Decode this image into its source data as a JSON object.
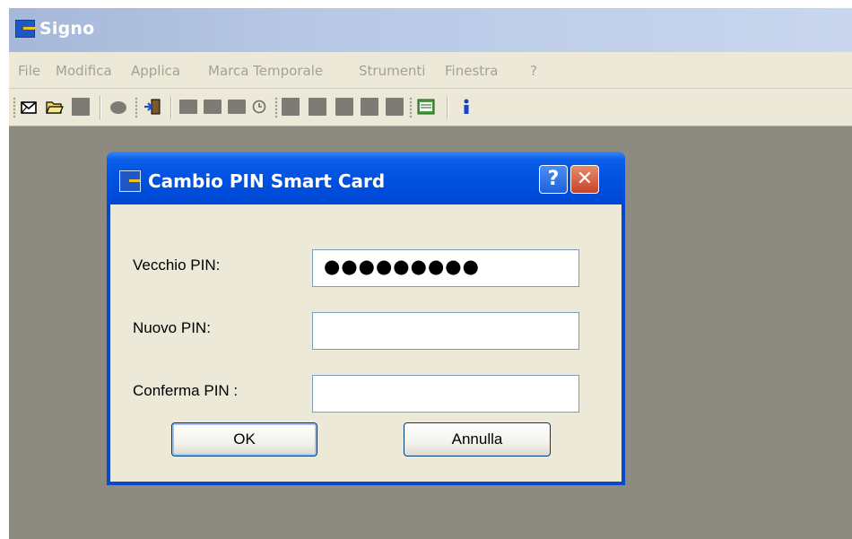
{
  "app": {
    "title": "Signo"
  },
  "menu": [
    "File",
    "Modifica",
    "Applica",
    "Marca Temporale",
    "Strumenti",
    "Finestra",
    "?"
  ],
  "toolbar": {
    "icons": [
      "new-envelope-icon",
      "open-folder-icon",
      "save-icon",
      "print-icon",
      "exit-icon",
      "sign-icon",
      "verify-icon",
      "countersign-icon",
      "timestamp-clock-icon",
      "encrypt-icon",
      "decrypt-icon",
      "archive-icon",
      "lock-icon",
      "certificate-icon",
      "settings-panel-icon",
      "info-icon"
    ]
  },
  "dialog": {
    "title": "Cambio PIN Smart Card",
    "help_label": "?",
    "close_label": "✕",
    "fields": [
      {
        "label": "Vecchio PIN:",
        "value": "●●●●●●●●●"
      },
      {
        "label": "Nuovo PIN:",
        "value": ""
      },
      {
        "label": "Conferma PIN :",
        "value": ""
      }
    ],
    "ok_label": "OK",
    "cancel_label": "Annulla"
  },
  "colors": {
    "title_active": "#0052e0",
    "workspace": "#8d8a81",
    "dialog_face": "#ece9d8"
  }
}
